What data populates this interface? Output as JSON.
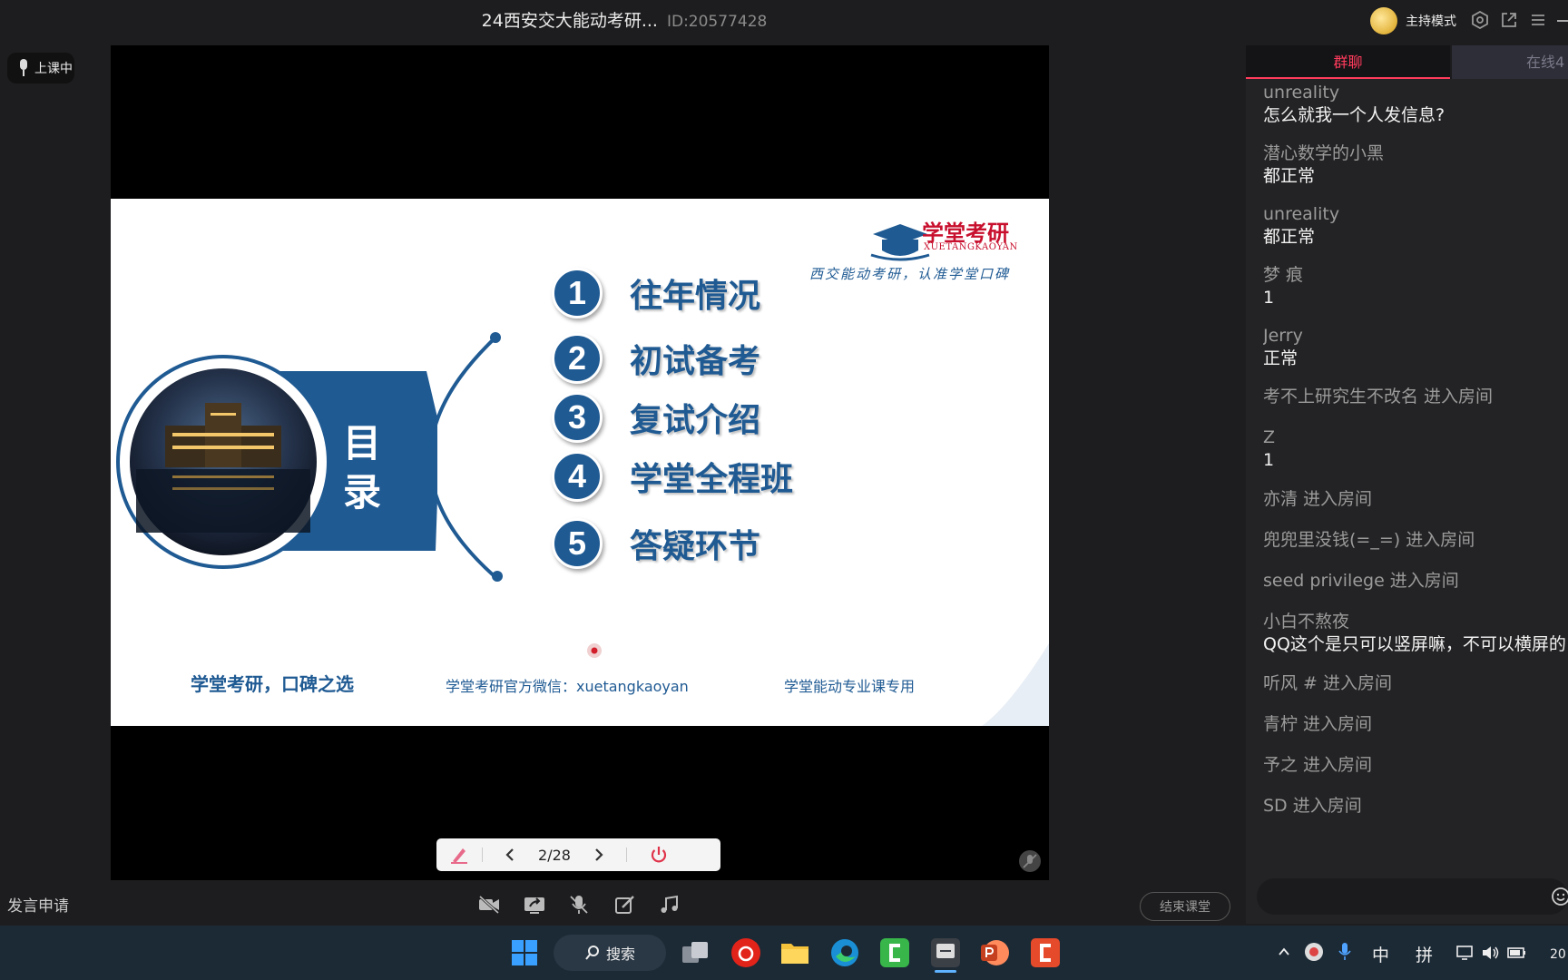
{
  "window": {
    "title": "24西安交大能动考研...",
    "room_id": "ID:20577428",
    "host_mode": "主持模式"
  },
  "class_status": "上课中",
  "slide": {
    "brand_name": "学堂考研",
    "brand_pinyin": "XUETANGKAOYAN",
    "tagline": "西交能动考研，认准学堂口碑",
    "toc_title_1": "目",
    "toc_title_2": "录",
    "items": [
      {
        "num": "1",
        "label": "往年情况"
      },
      {
        "num": "2",
        "label": "初试备考"
      },
      {
        "num": "3",
        "label": "复试介绍"
      },
      {
        "num": "4",
        "label": "学堂全程班"
      },
      {
        "num": "5",
        "label": "答疑环节"
      }
    ],
    "footer_left": "学堂考研，口碑之选",
    "footer_mid": "学堂考研官方微信：xuetangkaoyan",
    "footer_right": "学堂能动专业课专用"
  },
  "pager": {
    "page": "2/28"
  },
  "controls": {
    "speak_request": "发言申请",
    "end_class": "结束课堂"
  },
  "chat": {
    "tab_group": "群聊",
    "tab_online": "在线4",
    "messages": [
      {
        "user": "unreality",
        "text": "怎么就我一个人发信息?"
      },
      {
        "user": "潜心数学的小黑",
        "text": "都正常"
      },
      {
        "user": "unreality",
        "text": "都正常"
      },
      {
        "user": "梦 痕",
        "text": "1"
      },
      {
        "user": "Jerry",
        "text": "正常"
      }
    ],
    "system_1": "考不上研究生不改名 进入房间",
    "msg_z": {
      "user": "Z",
      "text": "1"
    },
    "system_2": [
      "亦清 进入房间",
      "兜兜里没钱(=_=) 进入房间",
      "seed privilege 进入房间"
    ],
    "msg_xb": {
      "user": "小白不熬夜",
      "text": "QQ这个是只可以竖屏嘛，不可以横屏的"
    },
    "system_3": [
      "听风 # 进入房间",
      "青柠 进入房间",
      "予之 进入房间",
      "SD 进入房间"
    ]
  },
  "taskbar": {
    "search": "搜索",
    "ime_1": "中",
    "ime_2": "拼",
    "clock": "20"
  },
  "colors": {
    "slide_blue": "#1f5a93",
    "accent_red": "#ff3b5c",
    "brand_red": "#c8102e"
  }
}
